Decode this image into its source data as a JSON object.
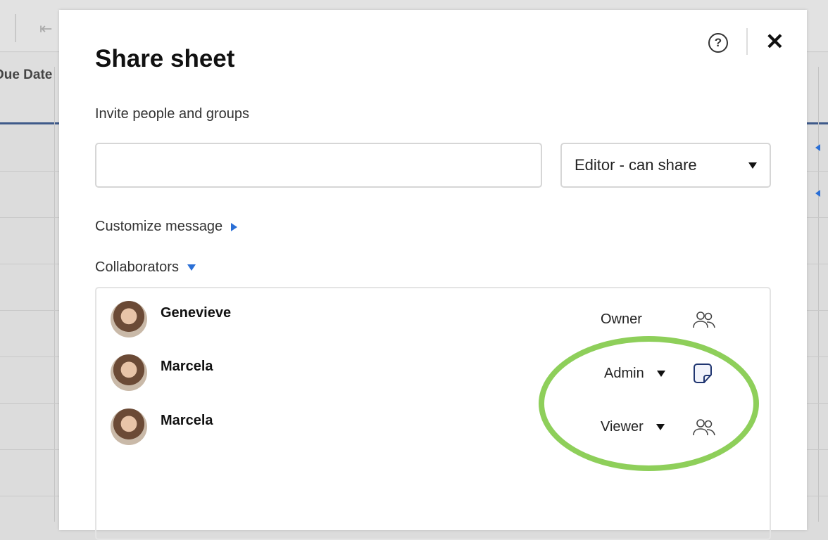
{
  "background": {
    "column_header": "Due Date"
  },
  "dialog": {
    "title": "Share sheet",
    "invite_label": "Invite people and groups",
    "invite_value": "",
    "permission_selected": "Editor - can share",
    "customize_message": "Customize message",
    "collaborators_label": "Collaborators",
    "collaborators": [
      {
        "name": "Genevieve",
        "role": "Owner",
        "icon": "group-icon"
      },
      {
        "name": "Marcela",
        "role": "Admin",
        "icon": "sticky-note-icon"
      },
      {
        "name": "Marcela",
        "role": "Viewer",
        "icon": "group-icon"
      }
    ]
  },
  "colors": {
    "accent": "#2a6fd6",
    "highlight": "#8ecf5a",
    "header_border": "#3f5a8a"
  }
}
